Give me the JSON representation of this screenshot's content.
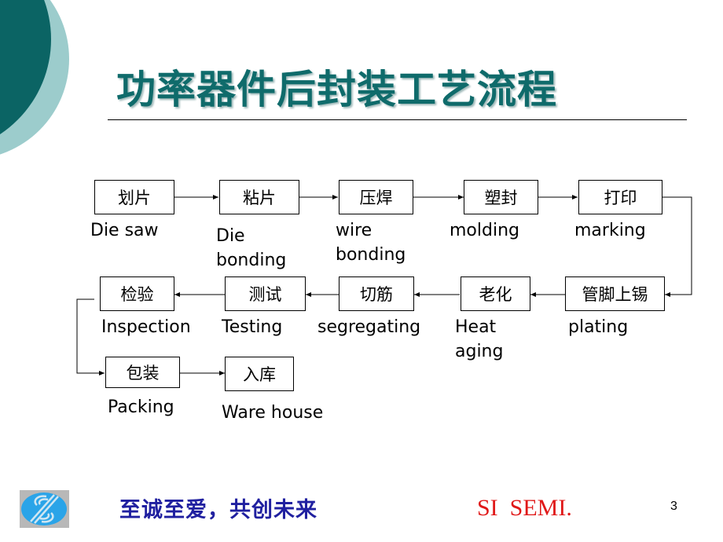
{
  "slide": {
    "title": "功率器件后封装工艺流程",
    "page_number": "3"
  },
  "colors": {
    "title": "#0f6b6b",
    "decor_dark": "#0b6464",
    "decor_light": "#9ccccc",
    "slogan": "#2020a0",
    "brand": "#e01818",
    "logo_blue": "#2aa4e8"
  },
  "flow": {
    "steps": [
      {
        "id": "s1",
        "zh": "划片",
        "en": "Die saw"
      },
      {
        "id": "s2",
        "zh": "粘片",
        "en": "Die\nbonding"
      },
      {
        "id": "s3",
        "zh": "压焊",
        "en": "wire\nbonding"
      },
      {
        "id": "s4",
        "zh": "塑封",
        "en": "molding"
      },
      {
        "id": "s5",
        "zh": "打印",
        "en": "marking"
      },
      {
        "id": "s6",
        "zh": "管脚上锡",
        "en": "plating"
      },
      {
        "id": "s7",
        "zh": "老化",
        "en": "Heat\naging"
      },
      {
        "id": "s8",
        "zh": "切筋",
        "en": "segregating"
      },
      {
        "id": "s9",
        "zh": "测试",
        "en": "Testing"
      },
      {
        "id": "s10",
        "zh": "检验",
        "en": "Inspection"
      },
      {
        "id": "s11",
        "zh": "包装",
        "en": "Packing"
      },
      {
        "id": "s12",
        "zh": "入库",
        "en": "Ware house"
      }
    ],
    "connections": [
      [
        "s1",
        "s2"
      ],
      [
        "s2",
        "s3"
      ],
      [
        "s3",
        "s4"
      ],
      [
        "s4",
        "s5"
      ],
      [
        "s5",
        "s6"
      ],
      [
        "s6",
        "s7"
      ],
      [
        "s7",
        "s8"
      ],
      [
        "s8",
        "s9"
      ],
      [
        "s9",
        "s10"
      ],
      [
        "s10",
        "s11"
      ],
      [
        "s11",
        "s12"
      ]
    ]
  },
  "footer": {
    "slogan": "至诚至爱，共创未来",
    "brand": "SI  SEMI.",
    "logo_icon": "si-semi-logo"
  }
}
